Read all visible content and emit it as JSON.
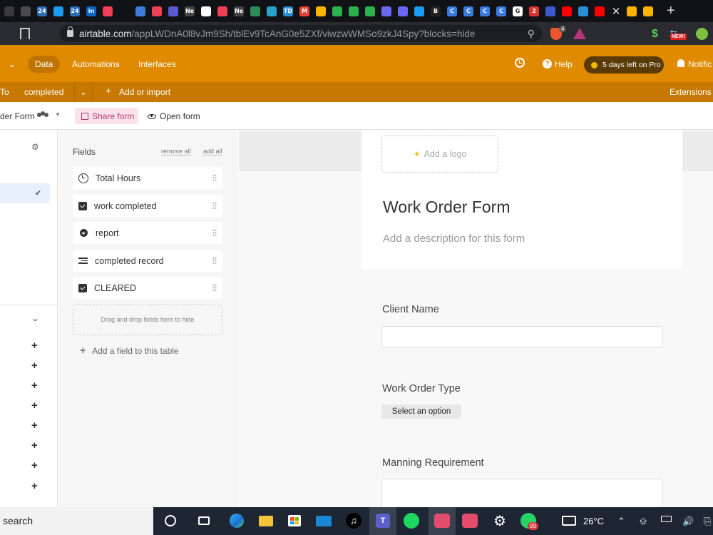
{
  "browser": {
    "url_host": "airtable.com",
    "url_path": "/appLWDnA0l8vJm9Sh/tblEv9TcAnG0e5ZXf/viwzwWMSo9zkJ4Spy?blocks=hide",
    "tab_favicons": [
      {
        "icon": "grid-icon",
        "color": "#3a3a3a",
        "text": ""
      },
      {
        "icon": "mail-icon",
        "color": "#4a4a4a",
        "text": ""
      },
      {
        "icon": "news24-icon",
        "color": "#2d6fb7",
        "text": "24"
      },
      {
        "icon": "twitter-icon",
        "color": "#1d9bf0",
        "text": ""
      },
      {
        "icon": "news24-icon",
        "color": "#2d6fb7",
        "text": "24"
      },
      {
        "icon": "linkedin-icon",
        "color": "#0a66c2",
        "text": "in"
      },
      {
        "icon": "pocket-icon",
        "color": "#ef4056",
        "text": ""
      },
      {
        "icon": "blank-icon",
        "color": "#111216",
        "text": ""
      },
      {
        "icon": "app-icon",
        "color": "#3b7dd8",
        "text": ""
      },
      {
        "icon": "pocket-icon",
        "color": "#ef4056",
        "text": ""
      },
      {
        "icon": "opera-icon",
        "color": "#5a5ad6",
        "text": ""
      },
      {
        "icon": "ne-icon",
        "color": "#444",
        "text": "Ne"
      },
      {
        "icon": "chrome-icon",
        "color": "#ffffff",
        "text": ""
      },
      {
        "icon": "pocket-icon",
        "color": "#ef4056",
        "text": ""
      },
      {
        "icon": "ne-icon",
        "color": "#444",
        "text": "Ne"
      },
      {
        "icon": "sheet-icon",
        "color": "#2e8b57",
        "text": ""
      },
      {
        "icon": "app-icon",
        "color": "#27a3c9",
        "text": ""
      },
      {
        "icon": "td-icon",
        "color": "#2a8fd6",
        "text": "TD"
      },
      {
        "icon": "gmail-icon",
        "color": "#ea4335",
        "text": "M"
      },
      {
        "icon": "airtable-icon",
        "color": "#f8b500",
        "text": ""
      },
      {
        "icon": "feedly-icon",
        "color": "#2bb24c",
        "text": ""
      },
      {
        "icon": "feedly-icon",
        "color": "#2bb24c",
        "text": ""
      },
      {
        "icon": "feedly-icon",
        "color": "#2bb24c",
        "text": ""
      },
      {
        "icon": "opera-icon",
        "color": "#6a6af0",
        "text": ""
      },
      {
        "icon": "opera-icon",
        "color": "#6a6af0",
        "text": ""
      },
      {
        "icon": "twitter-icon",
        "color": "#1d9bf0",
        "text": ""
      },
      {
        "icon": "bold-icon",
        "color": "#222",
        "text": "B"
      },
      {
        "icon": "c-icon",
        "color": "#3a7be0",
        "text": "C"
      },
      {
        "icon": "c-icon",
        "color": "#3a7be0",
        "text": "C"
      },
      {
        "icon": "c-icon",
        "color": "#3a7be0",
        "text": "C"
      },
      {
        "icon": "c-icon",
        "color": "#3a7be0",
        "text": "C"
      },
      {
        "icon": "google-icon",
        "color": "#ffffff",
        "text": "G"
      },
      {
        "icon": "two-icon",
        "color": "#d33",
        "text": "2"
      },
      {
        "icon": "x-icon",
        "color": "#3a5ad0",
        "text": ""
      },
      {
        "icon": "youtube-icon",
        "color": "#ff0000",
        "text": ""
      },
      {
        "icon": "app-icon",
        "color": "#2a8fd6",
        "text": ""
      },
      {
        "icon": "youtube-icon",
        "color": "#ff0000",
        "text": ""
      }
    ],
    "tail_favicons": [
      {
        "icon": "airtable-icon",
        "color": "#f8b500",
        "text": ""
      },
      {
        "icon": "airtable-icon",
        "color": "#f8b500",
        "text": ""
      }
    ],
    "new_badge": "NEW!",
    "brave_badge": "4"
  },
  "app": {
    "nav": {
      "data": "Data",
      "automations": "Automations",
      "interfaces": "Interfaces"
    },
    "help": "Help",
    "trial": "5 days left on Pro",
    "notifications": "Notific",
    "subbar": {
      "to": "To",
      "completed": "completed",
      "add_import": "Add or import",
      "extensions": "Extensions"
    },
    "viewbar": {
      "view_name": "der Form",
      "share": "Share form",
      "open": "Open form"
    }
  },
  "fields_panel": {
    "title": "Fields",
    "remove_all": "remove all",
    "add_all": "add all",
    "items": [
      {
        "label": "Total Hours",
        "icon": "clock-icon"
      },
      {
        "label": "work completed",
        "icon": "checkbox-icon"
      },
      {
        "label": "report",
        "icon": "dropdown-icon"
      },
      {
        "label": "completed record",
        "icon": "long-text-icon"
      },
      {
        "label": "CLEARED",
        "icon": "checkbox-icon"
      }
    ],
    "dropzone": "Drag and drop fields here to hide",
    "add_field": "Add a field to this table"
  },
  "form": {
    "add_logo": "Add a logo",
    "title": "Work Order Form",
    "description_placeholder": "Add a description for this form",
    "questions": [
      {
        "label": "Client Name"
      },
      {
        "label": "Work Order Type",
        "select": "Select an option"
      },
      {
        "label": "Manning Requirement"
      }
    ]
  },
  "taskbar": {
    "search": "search",
    "temperature": "26°C",
    "whatsapp_badge": "99"
  }
}
